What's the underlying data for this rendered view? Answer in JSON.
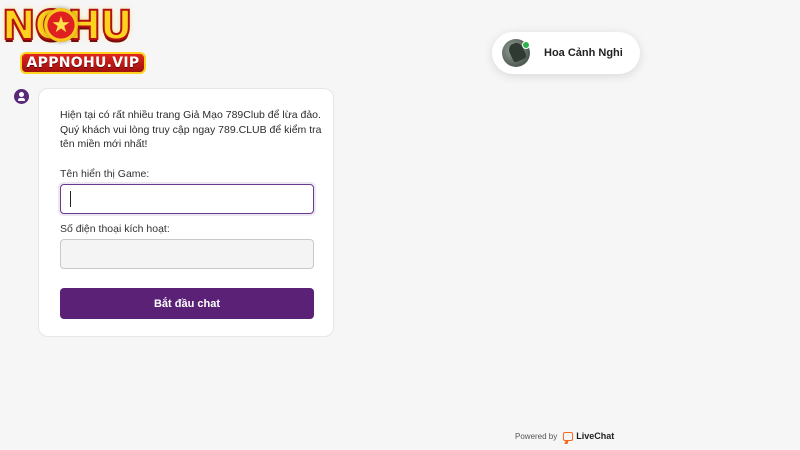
{
  "logo": {
    "brand_text": "NOHU",
    "star_glyph": "★",
    "ribbon_text": "APPNOHU.VIP"
  },
  "agent": {
    "name": "Hoa Cảnh Nghi",
    "status_color": "#2bb24c"
  },
  "form": {
    "intro": "Hiện tại có rất nhiều trang Giả Mạo 789Club để lừa đảo. Quý khách vui lòng truy cập ngay 789.CLUB để kiểm tra tên miền mới nhất!",
    "field_name_label": "Tên hiển thị Game:",
    "field_name_value": "",
    "field_phone_label": "Số điện thoại kích hoạt:",
    "field_phone_value": "",
    "submit_label": "Bắt đầu chat"
  },
  "footer": {
    "powered_by": "Powered by",
    "brand": "LiveChat"
  },
  "colors": {
    "accent": "#5a2176",
    "livechat_orange": "#f36a1d"
  }
}
